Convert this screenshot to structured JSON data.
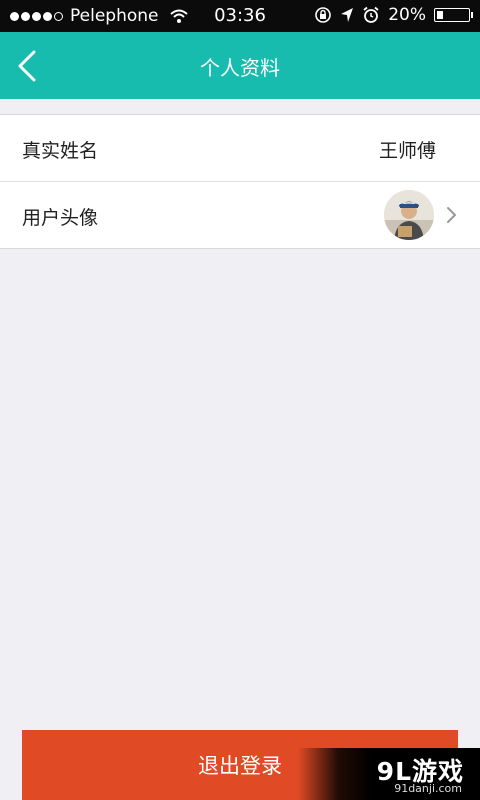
{
  "status_bar": {
    "carrier": "Pelephone",
    "time": "03:36",
    "battery": "20%",
    "battery_level": 0.2,
    "icons": [
      "signal-dots-icon",
      "wifi-icon",
      "rotation-lock-icon",
      "location-arrow-icon",
      "alarm-icon",
      "battery-icon"
    ]
  },
  "nav": {
    "title": "个人资料",
    "back_icon": "back-chevron-icon"
  },
  "profile": {
    "name_label": "真实姓名",
    "name_value": "王师傅",
    "avatar_label": "用户头像",
    "avatar_icon": "user-avatar-photo",
    "chevron_icon": "chevron-right-icon"
  },
  "logout": {
    "label": "退出登录"
  },
  "watermark": {
    "title": "9L游戏",
    "site": "91danji.com"
  },
  "colors": {
    "accent": "#17bcae",
    "logout": "#e04a24",
    "background": "#efeff4"
  }
}
